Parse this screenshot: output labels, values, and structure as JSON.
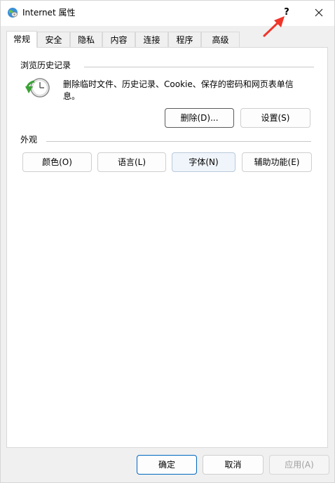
{
  "window": {
    "title": "Internet 属性",
    "help_label": "?",
    "close_icon": "close-icon"
  },
  "tabs": [
    {
      "label": "常规",
      "active": true
    },
    {
      "label": "安全",
      "active": false
    },
    {
      "label": "隐私",
      "active": false
    },
    {
      "label": "内容",
      "active": false
    },
    {
      "label": "连接",
      "active": false
    },
    {
      "label": "程序",
      "active": false
    },
    {
      "label": "高级",
      "active": false
    }
  ],
  "browsing_history": {
    "group_label": "浏览历史记录",
    "icon": "history-clock-icon",
    "description": "删除临时文件、历史记录、Cookie、保存的密码和网页表单信息。",
    "delete_button": "删除(D)...",
    "settings_button": "设置(S)"
  },
  "appearance": {
    "group_label": "外观",
    "colors_button": "颜色(O)",
    "languages_button": "语言(L)",
    "fonts_button": "字体(N)",
    "accessibility_button": "辅助功能(E)"
  },
  "footer": {
    "ok_button": "确定",
    "cancel_button": "取消",
    "apply_button": "应用(A)"
  },
  "colors": {
    "accent": "#0067c0",
    "annotation_arrow": "#f0352a"
  }
}
